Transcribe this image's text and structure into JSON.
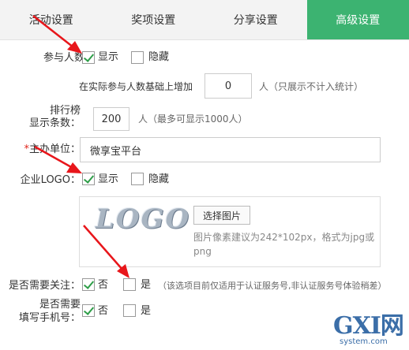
{
  "tabs": [
    {
      "label": "活动设置"
    },
    {
      "label": "奖项设置"
    },
    {
      "label": "分享设置"
    },
    {
      "label": "高级设置"
    }
  ],
  "participants": {
    "label": "参与人数：",
    "show": "显示",
    "hide": "隐藏",
    "add_prefix": "在实际参与人数基础上增加",
    "add_value": "0",
    "add_unit": "人（只展示不计入统计）"
  },
  "ranking": {
    "label_line1": "排行榜",
    "label_line2": "显示条数：",
    "value": "200",
    "unit": "人（最多可显示1000人）"
  },
  "organizer": {
    "required_mark": "*",
    "label": "主办单位：",
    "value": "微享宝平台"
  },
  "logo": {
    "label": "企业LOGO：",
    "show": "显示",
    "hide": "隐藏",
    "preview_text": "LOGO",
    "select_button": "选择图片",
    "hint": "图片像素建议为242*102px，格式为jpg或png"
  },
  "follow": {
    "label": "是否需要关注：",
    "no": "否",
    "yes": "是",
    "hint": "（该选项目前仅适用于认证服务号,非认证服务号体验稍差）"
  },
  "phone": {
    "label_line1": "是否需要",
    "label_line2": "填写手机号：",
    "no": "否",
    "yes": "是"
  },
  "watermark": {
    "brand": "GXI网",
    "site": "system.com"
  }
}
